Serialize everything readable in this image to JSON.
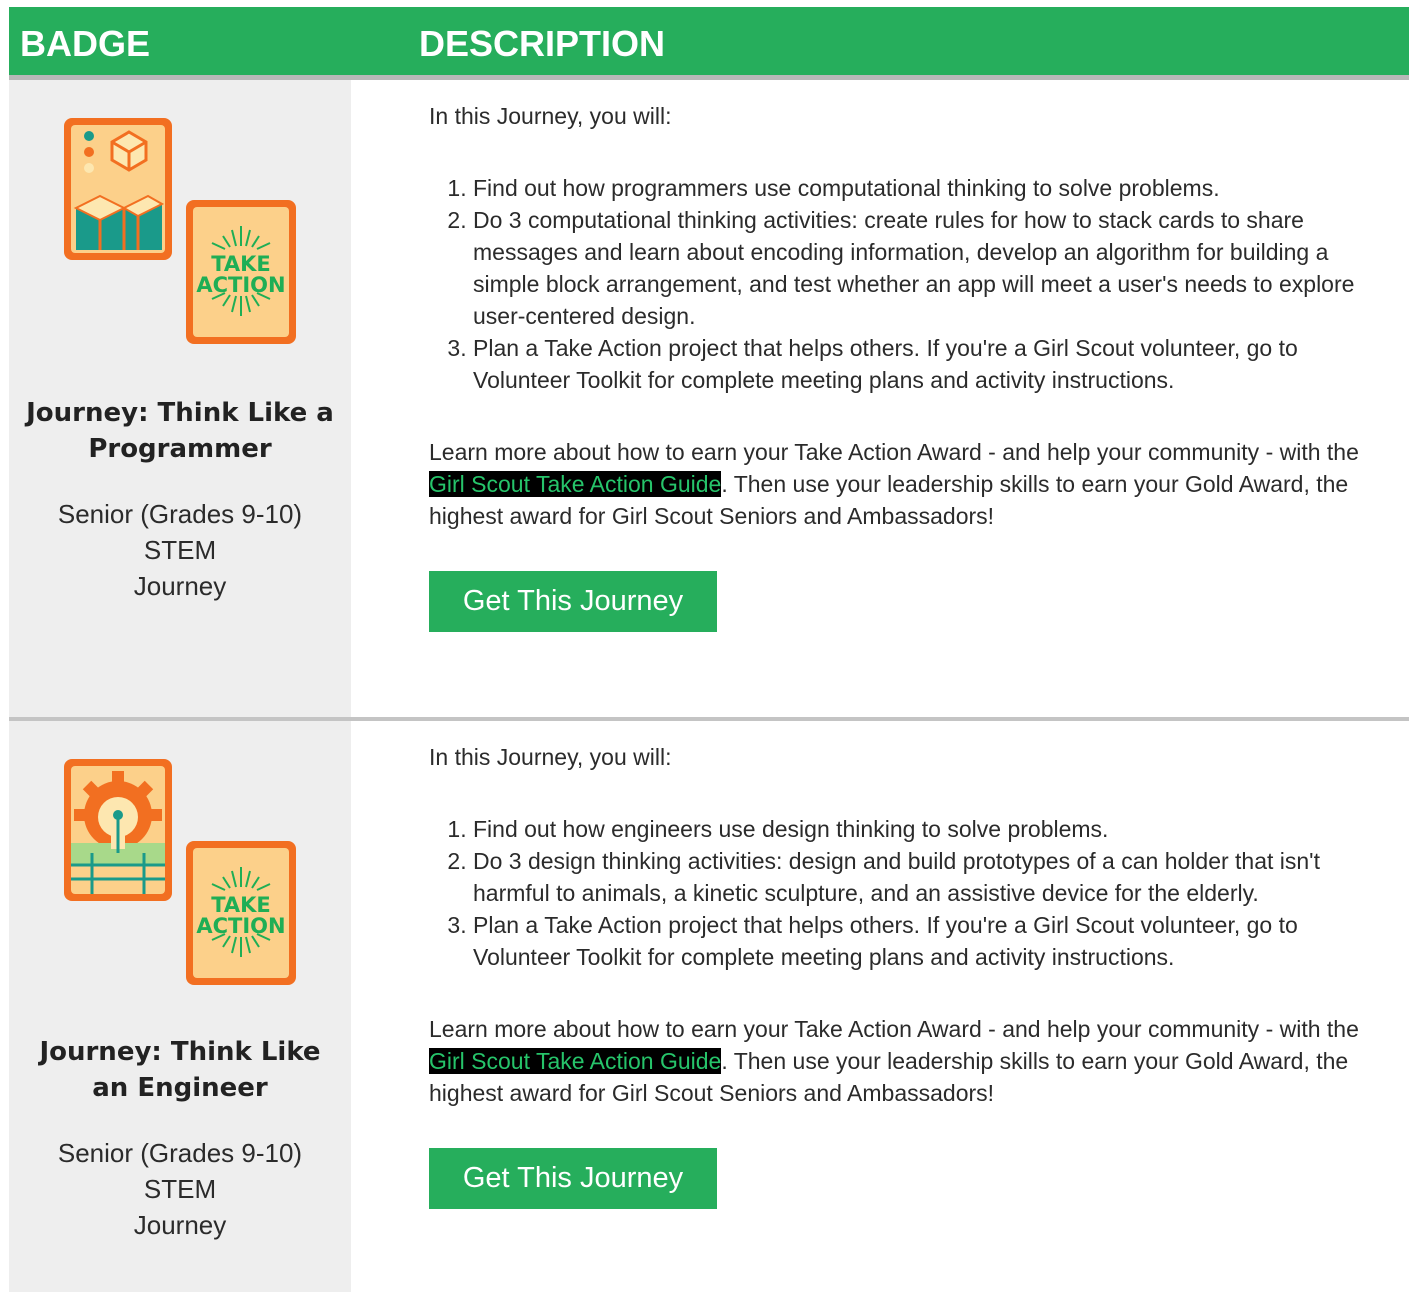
{
  "header": {
    "badge_label": "BADGE",
    "description_label": "DESCRIPTION"
  },
  "colors": {
    "brand_green": "#26ae5c",
    "link_green": "#26c46a",
    "badge_orange": "#f26f21",
    "badge_cream": "#fcd08a"
  },
  "rows": [
    {
      "icon": "computer-code-cube-badge",
      "take_action_icon": "take-action-badge",
      "take_action_text_1": "TAKE",
      "take_action_text_2": "ACTION",
      "title_line1": "Journey: Think Like a",
      "title_line2": "Programmer",
      "level": "Senior (Grades 9-10)",
      "category": "STEM",
      "type": "Journey",
      "intro": "In this Journey, you will:",
      "steps": [
        "Find out how programmers use computational thinking to solve problems.",
        "Do 3 computational thinking activities: create rules for how to stack cards to share messages and learn about encoding information, develop an algorithm for building a simple block arrangement, and test whether an app will meet a user's needs to explore user-centered design.",
        "Plan a Take Action project that helps others. If you're a Girl Scout volunteer, go to Volunteer Toolkit for complete meeting plans and activity instructions."
      ],
      "learn_before": "Learn more about how to earn your Take Action Award - and help your community - with the ",
      "learn_link": "Girl Scout Take Action Guide",
      "learn_after": ". Then use your leadership skills to earn your Gold Award, the highest award for Girl Scout Seniors and Ambassadors!",
      "button": "Get This Journey"
    },
    {
      "icon": "lightbulb-gear-badge",
      "take_action_icon": "take-action-badge",
      "take_action_text_1": "TAKE",
      "take_action_text_2": "ACTION",
      "title_line1": "Journey: Think Like",
      "title_line2": "an Engineer",
      "level": "Senior (Grades 9-10)",
      "category": "STEM",
      "type": "Journey",
      "intro": "In this Journey, you will:",
      "steps": [
        "Find out how engineers use design thinking to solve problems.",
        "Do 3 design thinking activities: design and build prototypes of a can holder that isn't harmful to animals, a kinetic sculpture, and an assistive device for the elderly.",
        "Plan a Take Action project that helps others. If you're a Girl Scout volunteer, go to Volunteer Toolkit for complete meeting plans and activity instructions."
      ],
      "learn_before": "Learn more about how to earn your Take Action Award - and help your community - with the ",
      "learn_link": "Girl Scout Take Action Guide",
      "learn_after": ". Then use your leadership skills to earn your Gold Award, the highest award for Girl Scout Seniors and Ambassadors!",
      "button": "Get This Journey"
    }
  ]
}
